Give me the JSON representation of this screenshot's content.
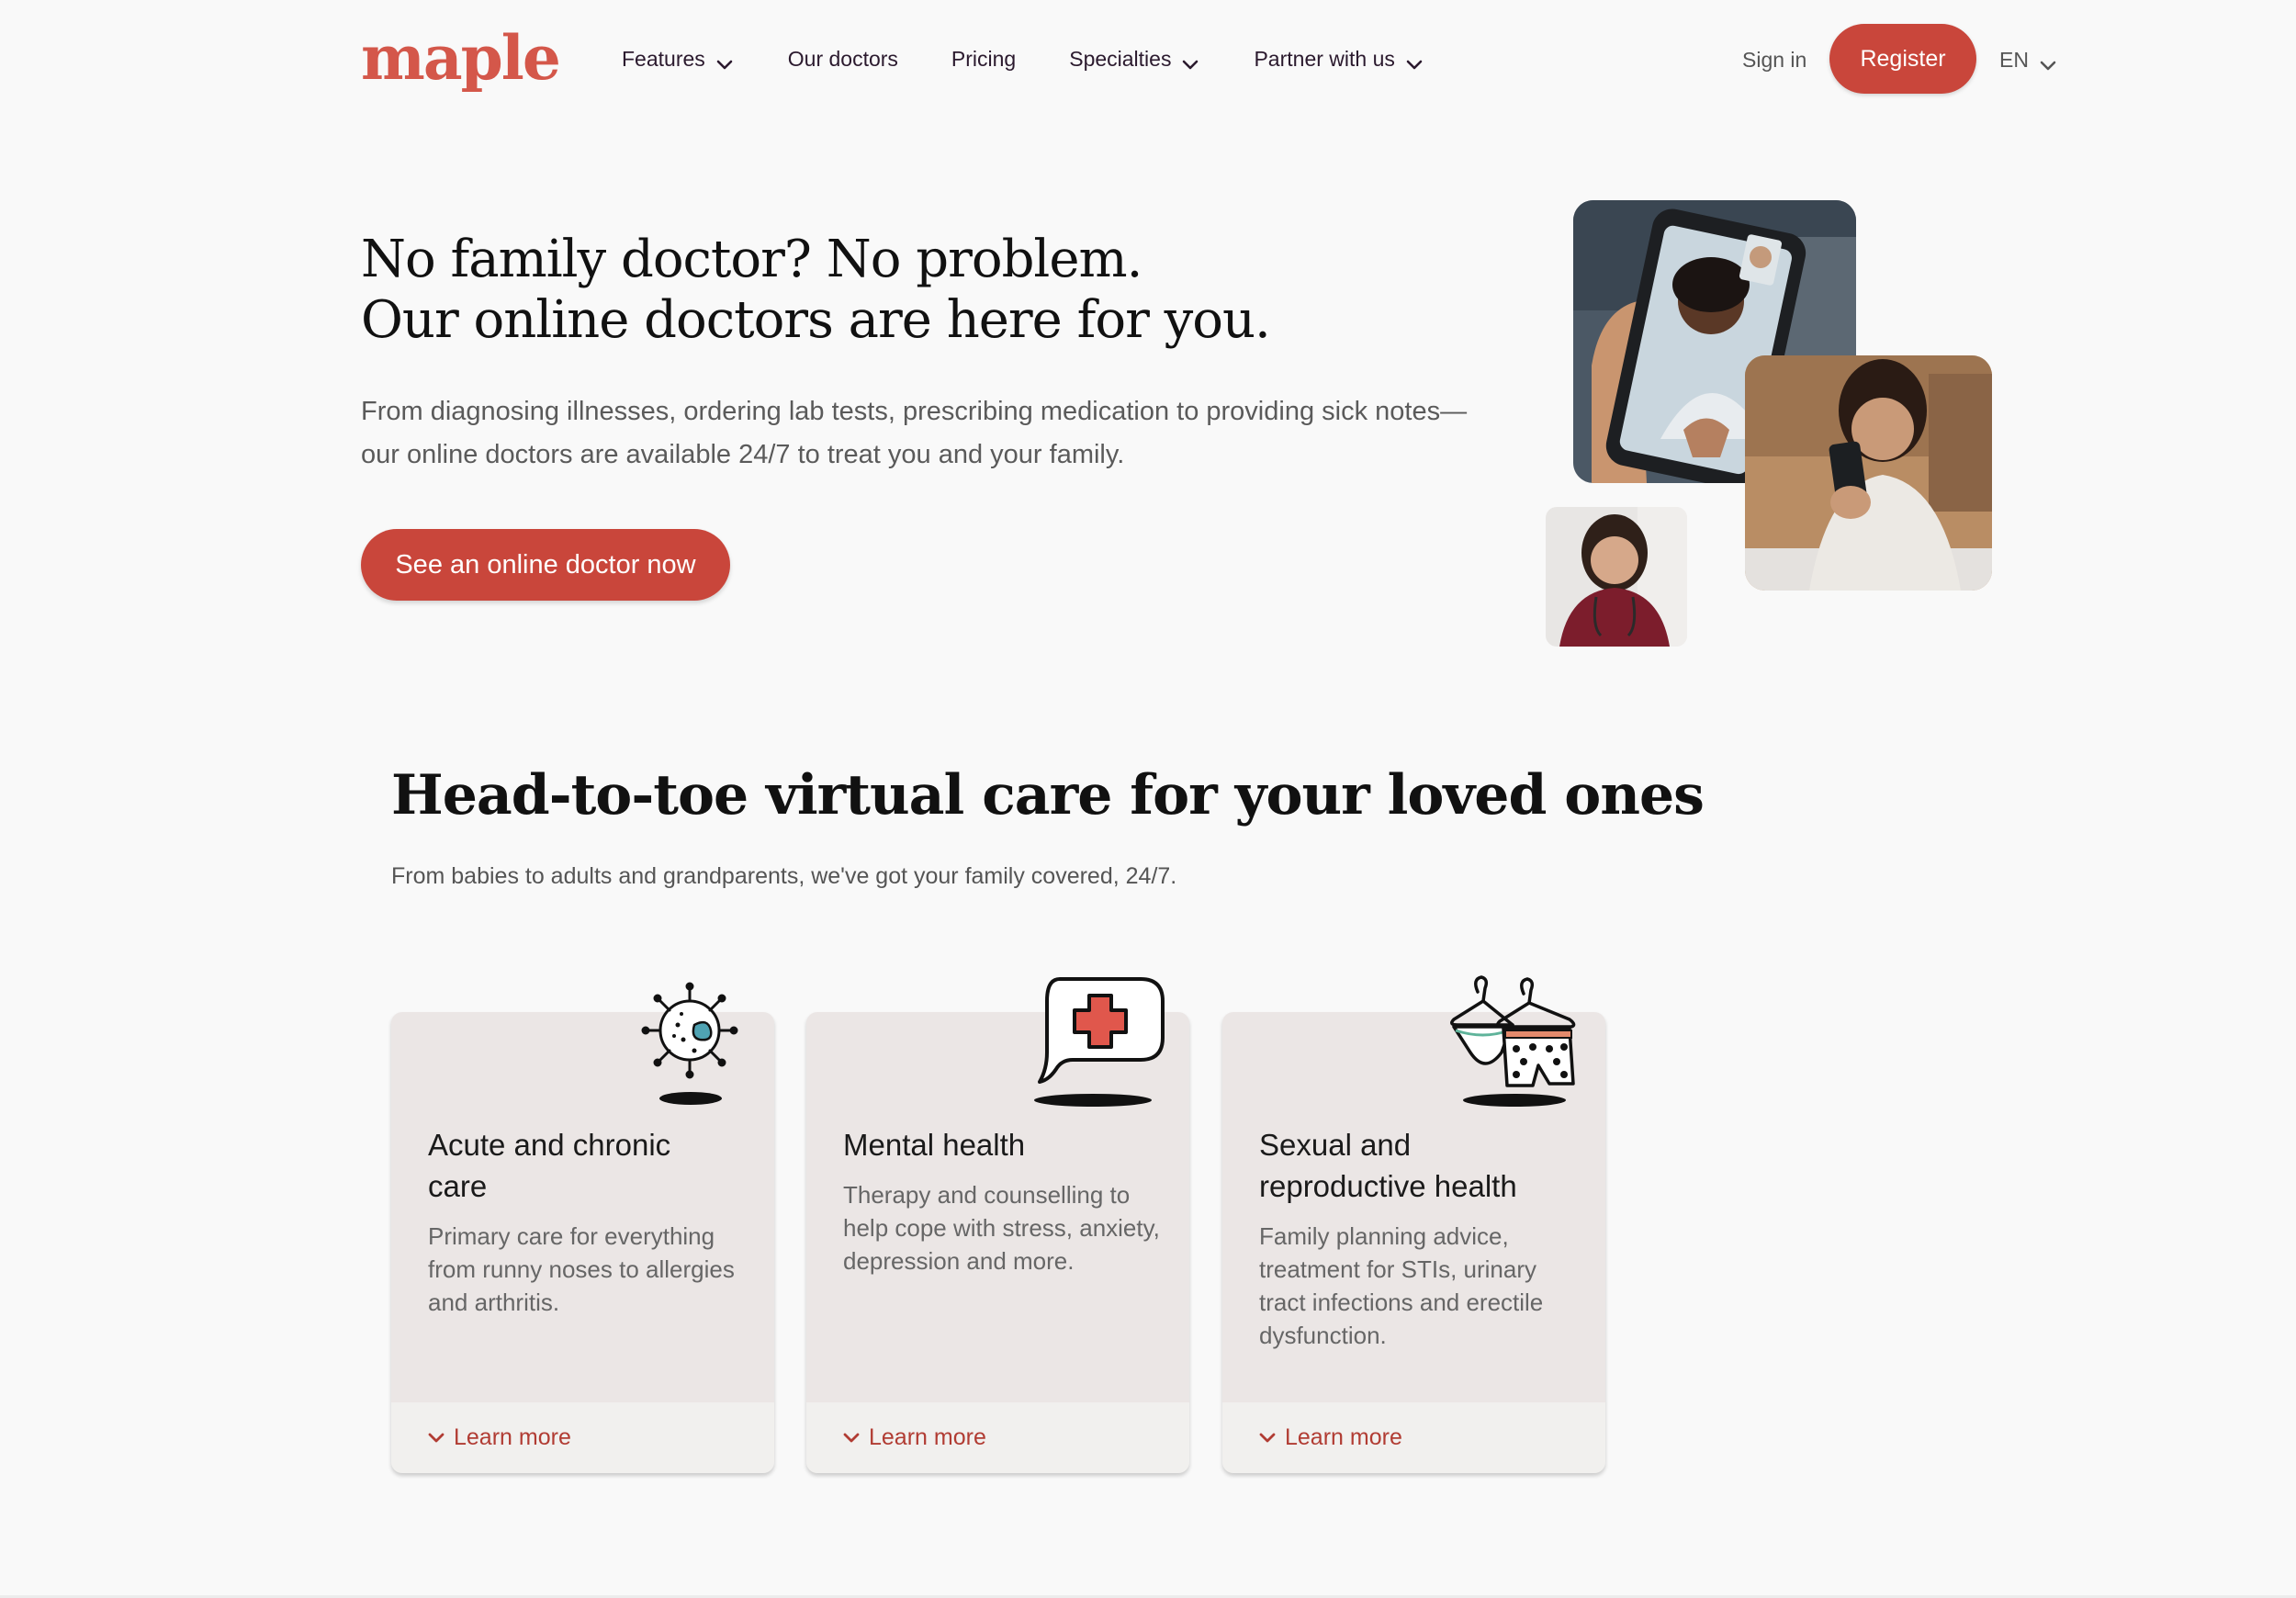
{
  "header": {
    "logo": "maple",
    "nav": [
      {
        "label": "Features",
        "has_dropdown": true
      },
      {
        "label": "Our doctors",
        "has_dropdown": false
      },
      {
        "label": "Pricing",
        "has_dropdown": false
      },
      {
        "label": "Specialties",
        "has_dropdown": true
      },
      {
        "label": "Partner with us",
        "has_dropdown": true
      }
    ],
    "sign_in": "Sign in",
    "register": "Register",
    "language": "EN"
  },
  "hero": {
    "title_line1": "No family doctor? No problem.",
    "title_line2": "Our online doctors are here for you.",
    "subtitle_line1": "From diagnosing illnesses, ordering lab tests, prescribing medication to providing sick notes—",
    "subtitle_line2": "our online doctors are available 24/7 to treat you and your family.",
    "cta": "See an online doctor now"
  },
  "care_section": {
    "title": "Head-to-toe virtual care for your loved ones",
    "subtitle": "From babies to adults and grandparents, we've got your family covered, 24/7.",
    "cards": [
      {
        "title_line1": "Acute and chronic",
        "title_line2": "care",
        "description": "Primary care for everything from runny noses to allergies and arthritis.",
        "link": "Learn more",
        "icon": "virus-icon"
      },
      {
        "title_line1": "Mental health",
        "title_line2": "",
        "description": "Therapy and counselling to help cope with stress, anxiety, depression and more.",
        "link": "Learn more",
        "icon": "medical-chat-icon"
      },
      {
        "title_line1": "Sexual and",
        "title_line2": "reproductive health",
        "description": "Family planning advice, treatment for STIs, urinary tract infections and erectile dysfunction.",
        "link": "Learn more",
        "icon": "underwear-hanger-icon"
      }
    ]
  },
  "colors": {
    "brand": "#d4574a",
    "button": "#c9463b",
    "link": "#b13c33",
    "card_bg": "#ebe6e5",
    "page_bg": "#f9f9f9"
  }
}
